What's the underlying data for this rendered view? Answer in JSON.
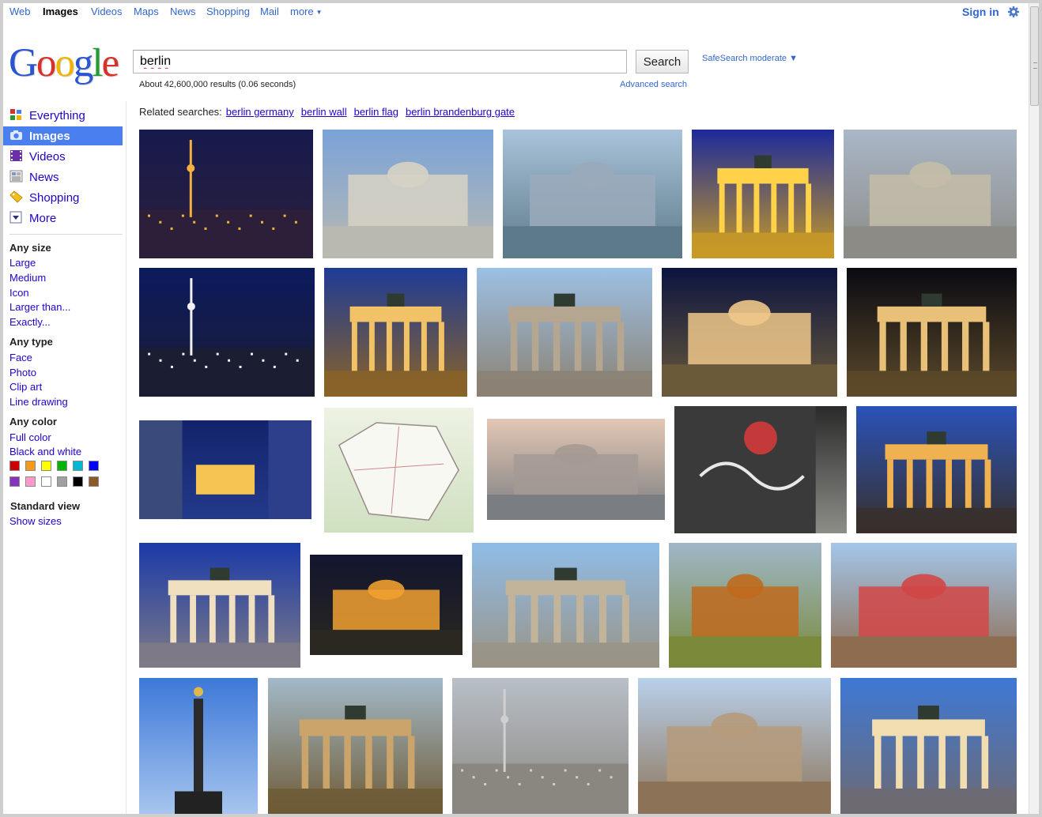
{
  "topnav": {
    "items": [
      {
        "label": "Web",
        "active": false
      },
      {
        "label": "Images",
        "active": true
      },
      {
        "label": "Videos",
        "active": false
      },
      {
        "label": "Maps",
        "active": false
      },
      {
        "label": "News",
        "active": false
      },
      {
        "label": "Shopping",
        "active": false
      },
      {
        "label": "Mail",
        "active": false
      },
      {
        "label": "more",
        "active": false
      }
    ],
    "sign_in": "Sign in",
    "settings_icon": "gear-icon"
  },
  "logo": {
    "text": "Google",
    "colors": [
      "#2a54d1",
      "#d9302a",
      "#f0b400",
      "#2a54d1",
      "#229b34",
      "#d9302a"
    ]
  },
  "search": {
    "query": "berlin",
    "button_label": "Search",
    "safesearch": "SafeSearch moderate ▼",
    "results_count": "About 42,600,000 results (0.06 seconds)",
    "advanced_search": "Advanced search"
  },
  "related": {
    "label": "Related searches:",
    "links": [
      "berlin germany",
      "berlin wall",
      "berlin flag",
      "berlin brandenburg gate"
    ]
  },
  "sidebar": {
    "modes": [
      {
        "label": "Everything",
        "icon": "everything-icon",
        "active": false
      },
      {
        "label": "Images",
        "icon": "camera-icon",
        "active": true
      },
      {
        "label": "Videos",
        "icon": "film-icon",
        "active": false
      },
      {
        "label": "News",
        "icon": "newspaper-icon",
        "active": false
      },
      {
        "label": "Shopping",
        "icon": "price-tag-icon",
        "active": false
      },
      {
        "label": "More",
        "icon": "chevron-down-icon",
        "active": false
      }
    ],
    "size": {
      "heading": "Any size",
      "options": [
        "Large",
        "Medium",
        "Icon",
        "Larger than...",
        "Exactly..."
      ]
    },
    "type": {
      "heading": "Any type",
      "options": [
        "Face",
        "Photo",
        "Clip art",
        "Line drawing"
      ]
    },
    "color": {
      "heading": "Any color",
      "options": [
        "Full color",
        "Black and white"
      ],
      "swatches": [
        "#cc0000",
        "#f79a1c",
        "#ffff00",
        "#00b400",
        "#00b8d4",
        "#0000ff",
        "#8833bb",
        "#ff99cc",
        "#ffffff",
        "#a0a0a0",
        "#000000",
        "#8b5a2b"
      ]
    },
    "view": {
      "heading": "Standard view",
      "link": "Show sizes"
    }
  },
  "thumbnails": [
    {
      "subject": "skyline-night",
      "c1": "#171a4d",
      "c2": "#2b1f3a",
      "accent": "#f3b040"
    },
    {
      "subject": "konzerthaus",
      "c1": "#7aa3d8",
      "c2": "#b9b9b2",
      "accent": "#d7d2c4"
    },
    {
      "subject": "river-city",
      "c1": "#a9c3da",
      "c2": "#5d7a8a",
      "accent": "#9aaabb"
    },
    {
      "subject": "brandenburg-gate-reflection",
      "c1": "#1c2a9a",
      "c2": "#c89a25",
      "accent": "#ffd24a"
    },
    {
      "subject": "gendarmenmarkt-aerial",
      "c1": "#a9b7c7",
      "c2": "#8c8b86",
      "accent": "#c4bca8"
    },
    {
      "subject": "tv-tower-night",
      "c1": "#0c1a5e",
      "c2": "#1b1d33",
      "accent": "#f1f1f1"
    },
    {
      "subject": "brandenburg-gate-night",
      "c1": "#1e3b96",
      "c2": "#8a6327",
      "accent": "#f2c266"
    },
    {
      "subject": "brandenburg-gate-day",
      "c1": "#9cc0e4",
      "c2": "#8b8173",
      "accent": "#b4a690"
    },
    {
      "subject": "berlin-cathedral-night",
      "c1": "#0b1440",
      "c2": "#6a5a3a",
      "accent": "#f0c88a"
    },
    {
      "subject": "brandenburg-gate-dark",
      "c1": "#0a0a12",
      "c2": "#5c4a2a",
      "accent": "#e8c078"
    },
    {
      "subject": "collage",
      "c1": "#13236b",
      "c2": "#233a8a",
      "accent": "#f5c453"
    },
    {
      "subject": "map",
      "c1": "#eef2e4",
      "c2": "#cfe0c0",
      "accent": "#9a8a8a"
    },
    {
      "subject": "skyline-dusk",
      "c1": "#e3c7b3",
      "c2": "#7a7d82",
      "accent": "#a59a94"
    },
    {
      "subject": "berlin-wall",
      "c1": "#2a2a2a",
      "c2": "#8d8d88",
      "accent": "#c43a3a"
    },
    {
      "subject": "brandenburg-gate-sunset",
      "c1": "#2a52b9",
      "c2": "#38302a",
      "accent": "#f0b250"
    },
    {
      "subject": "brandenburg-gate-blue",
      "c1": "#1a3aa8",
      "c2": "#7f7a86",
      "accent": "#f0e0c0"
    },
    {
      "subject": "street-night",
      "c1": "#12152e",
      "c2": "#2a2820",
      "accent": "#f0a030"
    },
    {
      "subject": "brandenburg-gate-wide",
      "c1": "#8fbde8",
      "c2": "#9a9386",
      "accent": "#c2b49a"
    },
    {
      "subject": "river-landscape",
      "c1": "#9fb7c8",
      "c2": "#7a8a3a",
      "accent": "#c06a1e"
    },
    {
      "subject": "city-bridge",
      "c1": "#a4c6ea",
      "c2": "#8e6c50",
      "accent": "#d24646"
    },
    {
      "subject": "victory-column",
      "c1": "#3d78d8",
      "c2": "#a8c6ef",
      "accent": "#e0b84a"
    },
    {
      "subject": "brandenburg-gate-evening",
      "c1": "#a2b9c8",
      "c2": "#6e5a34",
      "accent": "#caa46a"
    },
    {
      "subject": "skyline-tower",
      "c1": "#b8bfc7",
      "c2": "#8a8680",
      "accent": "#d0d0d0"
    },
    {
      "subject": "bode-museum",
      "c1": "#b8d0ea",
      "c2": "#8c7358",
      "accent": "#b59a7a"
    },
    {
      "subject": "brandenburg-gate-twilight",
      "c1": "#3e78d6",
      "c2": "#6e6a70",
      "accent": "#f2ddb0"
    }
  ]
}
